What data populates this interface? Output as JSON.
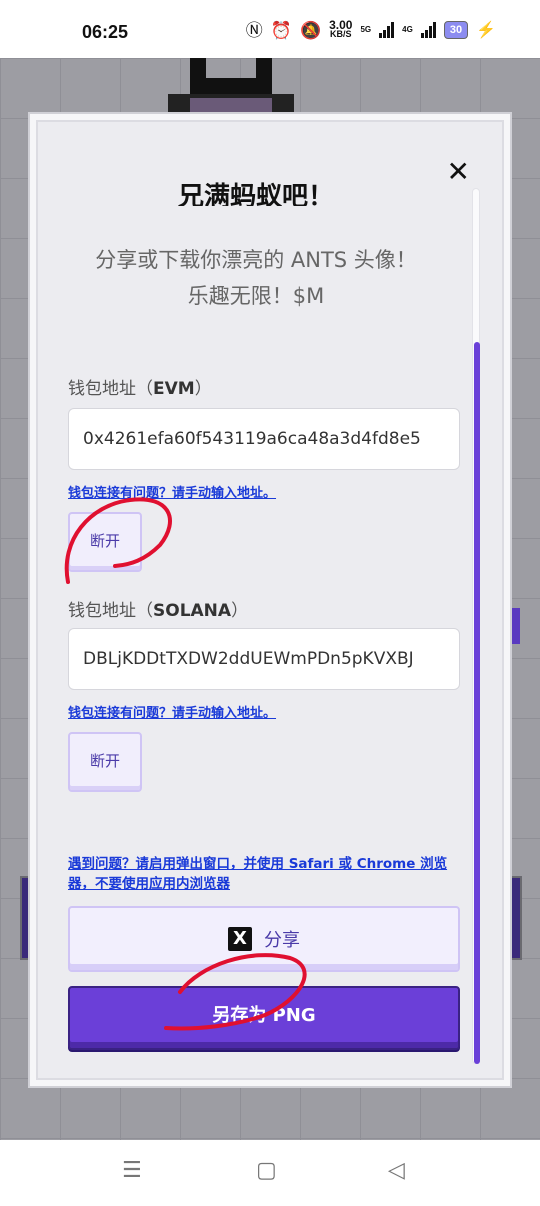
{
  "status_bar": {
    "time": "06:25",
    "speed_value": "3.00",
    "speed_unit": "KB/S",
    "net1": "5G",
    "net2": "4G",
    "battery": "30"
  },
  "modal": {
    "title": "兄满蚂蚁吧！",
    "subtitle_line1": "分享或下载你漂亮的 ANTS 头像！",
    "subtitle_line2": "乐趣无限！$M",
    "evm": {
      "label_prefix": "钱包地址（",
      "label_chain": "EVM",
      "label_suffix": "）",
      "address": "0x4261efa60f543119a6ca48a3d4fd8e5",
      "help": "钱包连接有问题？请手动输入地址。",
      "disconnect": "断开"
    },
    "solana": {
      "label_prefix": "钱包地址（",
      "label_chain": "SOLANA",
      "label_suffix": "）",
      "address": "DBLjKDDtTXDW2ddUEWmPDn5pKVXBJ",
      "help": "钱包连接有问题？请手动输入地址。",
      "disconnect": "断开"
    },
    "browser_help": "遇到问题？请启用弹出窗口，并使用 Safari 或 Chrome 浏览器，不要使用应用内浏览器",
    "share_label": "分享",
    "x_logo": "X",
    "save_png": "另存为 PNG",
    "close_icon": "close-icon"
  },
  "nav": {
    "menu": "☰",
    "home": "▢",
    "back": "◁"
  },
  "colors": {
    "accent": "#6b3fd8",
    "link": "#1a3ad8",
    "annotation": "#e01030"
  }
}
